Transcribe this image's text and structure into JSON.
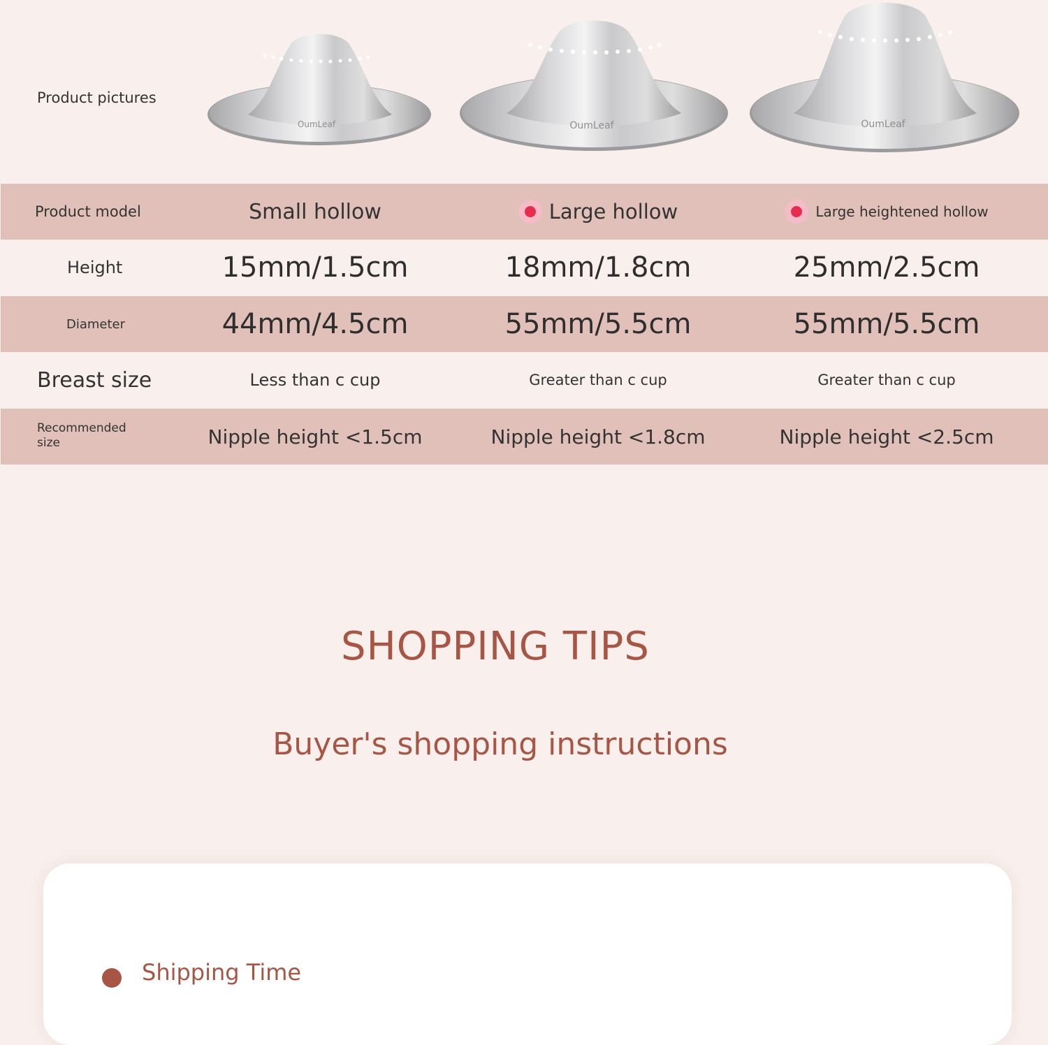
{
  "table": {
    "pictures_label": "Product pictures",
    "rows": {
      "model": {
        "label": "Product model",
        "values": [
          "Small hollow",
          "Large hollow",
          "Large heightened hollow"
        ]
      },
      "height": {
        "label": "Height",
        "values": [
          "15mm/1.5cm",
          "18mm/1.8cm",
          "25mm/2.5cm"
        ]
      },
      "diameter": {
        "label": "Diameter",
        "values": [
          "44mm/4.5cm",
          "55mm/5.5cm",
          "55mm/5.5cm"
        ]
      },
      "breast_size": {
        "label": "Breast size",
        "values": [
          "Less than c cup",
          "Greater than c cup",
          "Greater than c cup"
        ]
      },
      "recommended": {
        "label": "Recommended size",
        "values": [
          "Nipple height <1.5cm",
          "Nipple height <1.8cm",
          "Nipple height <2.5cm"
        ]
      }
    },
    "product_logo_text": "OumLeaf"
  },
  "tips": {
    "title": "SHOPPING TIPS",
    "subtitle": "Buyer's shopping instructions"
  },
  "card": {
    "item_title": "Shipping Time"
  },
  "colors": {
    "background": "#f9f0ed",
    "row_pink": "#e2c0ba",
    "accent": "#a75544",
    "dot": "#e72d4d",
    "dot_ring": "#f4bcc6"
  }
}
